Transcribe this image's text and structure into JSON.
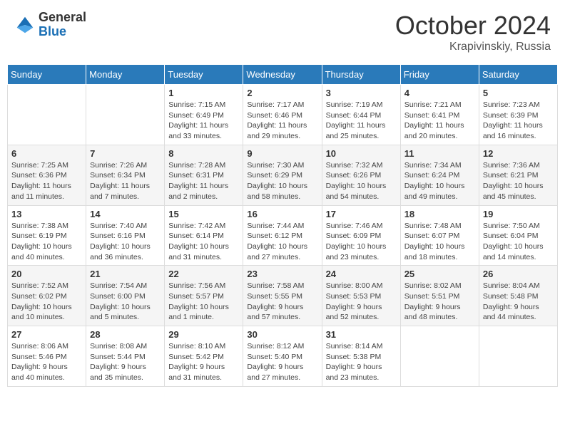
{
  "logo": {
    "line1": "General",
    "line2": "Blue"
  },
  "title": "October 2024",
  "subtitle": "Krapivinskiy, Russia",
  "weekdays": [
    "Sunday",
    "Monday",
    "Tuesday",
    "Wednesday",
    "Thursday",
    "Friday",
    "Saturday"
  ],
  "weeks": [
    [
      null,
      null,
      {
        "day": "1",
        "sunrise": "Sunrise: 7:15 AM",
        "sunset": "Sunset: 6:49 PM",
        "daylight": "Daylight: 11 hours and 33 minutes."
      },
      {
        "day": "2",
        "sunrise": "Sunrise: 7:17 AM",
        "sunset": "Sunset: 6:46 PM",
        "daylight": "Daylight: 11 hours and 29 minutes."
      },
      {
        "day": "3",
        "sunrise": "Sunrise: 7:19 AM",
        "sunset": "Sunset: 6:44 PM",
        "daylight": "Daylight: 11 hours and 25 minutes."
      },
      {
        "day": "4",
        "sunrise": "Sunrise: 7:21 AM",
        "sunset": "Sunset: 6:41 PM",
        "daylight": "Daylight: 11 hours and 20 minutes."
      },
      {
        "day": "5",
        "sunrise": "Sunrise: 7:23 AM",
        "sunset": "Sunset: 6:39 PM",
        "daylight": "Daylight: 11 hours and 16 minutes."
      }
    ],
    [
      {
        "day": "6",
        "sunrise": "Sunrise: 7:25 AM",
        "sunset": "Sunset: 6:36 PM",
        "daylight": "Daylight: 11 hours and 11 minutes."
      },
      {
        "day": "7",
        "sunrise": "Sunrise: 7:26 AM",
        "sunset": "Sunset: 6:34 PM",
        "daylight": "Daylight: 11 hours and 7 minutes."
      },
      {
        "day": "8",
        "sunrise": "Sunrise: 7:28 AM",
        "sunset": "Sunset: 6:31 PM",
        "daylight": "Daylight: 11 hours and 2 minutes."
      },
      {
        "day": "9",
        "sunrise": "Sunrise: 7:30 AM",
        "sunset": "Sunset: 6:29 PM",
        "daylight": "Daylight: 10 hours and 58 minutes."
      },
      {
        "day": "10",
        "sunrise": "Sunrise: 7:32 AM",
        "sunset": "Sunset: 6:26 PM",
        "daylight": "Daylight: 10 hours and 54 minutes."
      },
      {
        "day": "11",
        "sunrise": "Sunrise: 7:34 AM",
        "sunset": "Sunset: 6:24 PM",
        "daylight": "Daylight: 10 hours and 49 minutes."
      },
      {
        "day": "12",
        "sunrise": "Sunrise: 7:36 AM",
        "sunset": "Sunset: 6:21 PM",
        "daylight": "Daylight: 10 hours and 45 minutes."
      }
    ],
    [
      {
        "day": "13",
        "sunrise": "Sunrise: 7:38 AM",
        "sunset": "Sunset: 6:19 PM",
        "daylight": "Daylight: 10 hours and 40 minutes."
      },
      {
        "day": "14",
        "sunrise": "Sunrise: 7:40 AM",
        "sunset": "Sunset: 6:16 PM",
        "daylight": "Daylight: 10 hours and 36 minutes."
      },
      {
        "day": "15",
        "sunrise": "Sunrise: 7:42 AM",
        "sunset": "Sunset: 6:14 PM",
        "daylight": "Daylight: 10 hours and 31 minutes."
      },
      {
        "day": "16",
        "sunrise": "Sunrise: 7:44 AM",
        "sunset": "Sunset: 6:12 PM",
        "daylight": "Daylight: 10 hours and 27 minutes."
      },
      {
        "day": "17",
        "sunrise": "Sunrise: 7:46 AM",
        "sunset": "Sunset: 6:09 PM",
        "daylight": "Daylight: 10 hours and 23 minutes."
      },
      {
        "day": "18",
        "sunrise": "Sunrise: 7:48 AM",
        "sunset": "Sunset: 6:07 PM",
        "daylight": "Daylight: 10 hours and 18 minutes."
      },
      {
        "day": "19",
        "sunrise": "Sunrise: 7:50 AM",
        "sunset": "Sunset: 6:04 PM",
        "daylight": "Daylight: 10 hours and 14 minutes."
      }
    ],
    [
      {
        "day": "20",
        "sunrise": "Sunrise: 7:52 AM",
        "sunset": "Sunset: 6:02 PM",
        "daylight": "Daylight: 10 hours and 10 minutes."
      },
      {
        "day": "21",
        "sunrise": "Sunrise: 7:54 AM",
        "sunset": "Sunset: 6:00 PM",
        "daylight": "Daylight: 10 hours and 5 minutes."
      },
      {
        "day": "22",
        "sunrise": "Sunrise: 7:56 AM",
        "sunset": "Sunset: 5:57 PM",
        "daylight": "Daylight: 10 hours and 1 minute."
      },
      {
        "day": "23",
        "sunrise": "Sunrise: 7:58 AM",
        "sunset": "Sunset: 5:55 PM",
        "daylight": "Daylight: 9 hours and 57 minutes."
      },
      {
        "day": "24",
        "sunrise": "Sunrise: 8:00 AM",
        "sunset": "Sunset: 5:53 PM",
        "daylight": "Daylight: 9 hours and 52 minutes."
      },
      {
        "day": "25",
        "sunrise": "Sunrise: 8:02 AM",
        "sunset": "Sunset: 5:51 PM",
        "daylight": "Daylight: 9 hours and 48 minutes."
      },
      {
        "day": "26",
        "sunrise": "Sunrise: 8:04 AM",
        "sunset": "Sunset: 5:48 PM",
        "daylight": "Daylight: 9 hours and 44 minutes."
      }
    ],
    [
      {
        "day": "27",
        "sunrise": "Sunrise: 8:06 AM",
        "sunset": "Sunset: 5:46 PM",
        "daylight": "Daylight: 9 hours and 40 minutes."
      },
      {
        "day": "28",
        "sunrise": "Sunrise: 8:08 AM",
        "sunset": "Sunset: 5:44 PM",
        "daylight": "Daylight: 9 hours and 35 minutes."
      },
      {
        "day": "29",
        "sunrise": "Sunrise: 8:10 AM",
        "sunset": "Sunset: 5:42 PM",
        "daylight": "Daylight: 9 hours and 31 minutes."
      },
      {
        "day": "30",
        "sunrise": "Sunrise: 8:12 AM",
        "sunset": "Sunset: 5:40 PM",
        "daylight": "Daylight: 9 hours and 27 minutes."
      },
      {
        "day": "31",
        "sunrise": "Sunrise: 8:14 AM",
        "sunset": "Sunset: 5:38 PM",
        "daylight": "Daylight: 9 hours and 23 minutes."
      },
      null,
      null
    ]
  ]
}
